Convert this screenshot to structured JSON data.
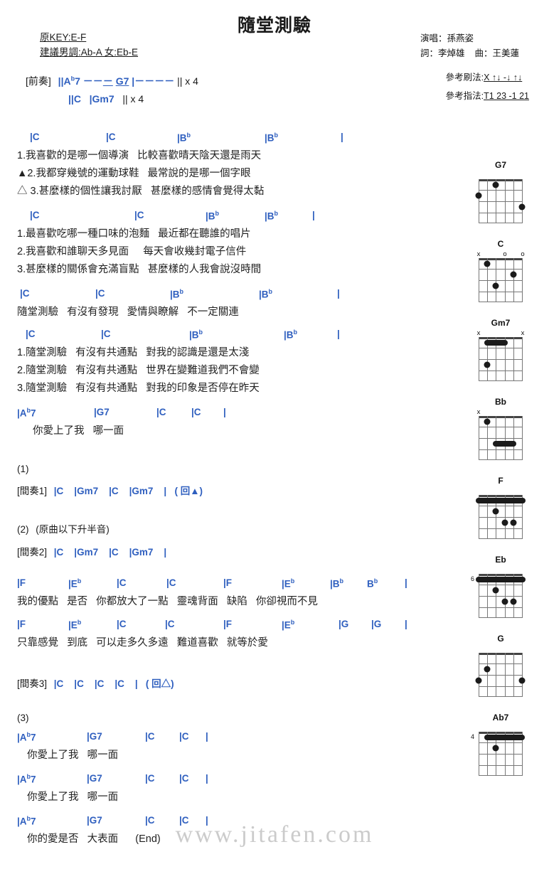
{
  "title": "隨堂測驗",
  "header": {
    "key_line": "原KEY:E-F",
    "suggest_line": "建議男調:Ab-A 女:Eb-E",
    "singer": "演唱：孫燕姿",
    "lyricist": "詞：李焯雄",
    "composer": "曲：王美蓮",
    "strum_label": "參考刷法:",
    "strum_value": "X ↑↓  -↓ ↑↓",
    "finger_label": "參考指法:",
    "finger_value": "T1 23 -1 21"
  },
  "intro": {
    "label": "[前奏]",
    "line1_chords": "||Ab7  －－－  G7  |－－－－  || x 4",
    "line2_chords": "||C    |Gm7    || x 4"
  },
  "sections": [
    {
      "name": "verse1",
      "chords": [
        "|C",
        "|C",
        "|Bb",
        "|Bb",
        "|"
      ],
      "lyrics": [
        "1.我喜歡的是哪一個導演   比較喜歡晴天陰天還是雨天",
        "▲2.我都穿幾號的運動球鞋   最常說的是哪一個字眼",
        "△ 3.甚麼樣的個性讓我討厭   甚麼樣的感情會覺得太黏"
      ]
    },
    {
      "name": "verse2",
      "chords": [
        "|C",
        "|C",
        "|Bb",
        "|Bb",
        "|"
      ],
      "lyrics": [
        "1.最喜歡吃哪一種口味的泡麵   最近都在聽誰的唱片",
        "2.我喜歡和誰聊天多見面     每天會收幾封電子信件",
        "3.甚麼樣的關係會充滿盲點   甚麼樣的人我會說沒時間"
      ]
    },
    {
      "name": "chorus-intro",
      "chords": [
        "|C",
        "|C",
        "|Bb",
        "|Bb",
        "|"
      ],
      "lyrics": [
        "隨堂測驗   有沒有發現   愛情與瞭解   不一定關連"
      ]
    },
    {
      "name": "chorus",
      "chords": [
        "|C",
        "|C",
        "|Bb",
        "|Bb",
        "|"
      ],
      "lyrics": [
        "1.隨堂測驗   有沒有共通點   對我的認識是還是太淺",
        "2.隨堂測驗   有沒有共通點   世界在變難道我們不會變",
        "3.隨堂測驗   有沒有共通點   對我的印象是否停在昨天"
      ]
    },
    {
      "name": "tag1",
      "chords": [
        "|Ab7",
        "|G7",
        "|C",
        "|C",
        "|"
      ],
      "lyrics": [
        "你愛上了我   哪一面"
      ]
    }
  ],
  "interlude1": {
    "number": "(1)",
    "label": "[間奏1]",
    "chords": "|C    |Gm7    |C    |Gm7    |   ( 回▲)"
  },
  "interlude2": {
    "number": "(2)",
    "note": "(原曲以下升半音)",
    "label": "[間奏2]",
    "chords": "|C    |Gm7    |C    |Gm7    |"
  },
  "bridge1": {
    "chords": [
      "|F",
      "|Eb",
      "|C",
      "|C",
      "|F",
      "|Eb",
      "|Bb",
      "Bb",
      "|"
    ],
    "lyric": "我的優點   是否   你都放大了一點   靈魂背面   缺陷   你卻視而不見"
  },
  "bridge2": {
    "chords": [
      "|F",
      "|Eb",
      "|C",
      "|C",
      "|F",
      "|Eb",
      "|G",
      "|G",
      "|"
    ],
    "lyric": "只靠感覺   到底   可以走多久多遠   難道喜歡   就等於愛"
  },
  "interlude3": {
    "label": "[間奏3]",
    "chords": "|C    |C    |C    |C    |   ( 回△)"
  },
  "ending": {
    "number": "(3)",
    "lines": [
      {
        "chords": [
          "|Ab7",
          "|G7",
          "|C",
          "|C",
          "|"
        ],
        "lyric": "你愛上了我   哪一面"
      },
      {
        "chords": [
          "|Ab7",
          "|G7",
          "|C",
          "|C",
          "|"
        ],
        "lyric": "你愛上了我   哪一面"
      },
      {
        "chords": [
          "|Ab7",
          "|G7",
          "|C",
          "|C",
          "|"
        ],
        "lyric": "你的愛是否   大表面      (End)"
      }
    ]
  },
  "diagrams": [
    {
      "name": "G7",
      "top": [
        {
          "label": "",
          "x": 0
        }
      ],
      "fret_label": "",
      "dots": [
        [
          2,
          1
        ],
        [
          0,
          2
        ],
        [
          5,
          3
        ]
      ],
      "barre": null
    },
    {
      "name": "C",
      "top": [
        {
          "label": "x",
          "x": 0
        },
        {
          "label": "o",
          "x": 3
        },
        {
          "label": "o",
          "x": 5
        }
      ],
      "fret_label": "",
      "dots": [
        [
          1,
          1
        ],
        [
          4,
          2
        ],
        [
          2,
          3
        ]
      ],
      "barre": null
    },
    {
      "name": "Gm7",
      "top": [
        {
          "label": "x",
          "x": 0
        },
        {
          "label": "x",
          "x": 5
        }
      ],
      "fret_label": "",
      "dots": [
        [
          1,
          1
        ],
        [
          2,
          1
        ],
        [
          3,
          1
        ],
        [
          4,
          1
        ],
        [
          1,
          3
        ]
      ],
      "barre": {
        "from": 1,
        "to": 4,
        "fret": 1
      }
    },
    {
      "name": "Bb",
      "top": [
        {
          "label": "x",
          "x": 0
        }
      ],
      "fret_label": "",
      "dots": [
        [
          1,
          1
        ],
        [
          2,
          3
        ],
        [
          3,
          3
        ],
        [
          4,
          3
        ],
        [
          5,
          3
        ]
      ],
      "barre": {
        "from": 2,
        "to": 5,
        "fret": 3
      }
    },
    {
      "name": "F",
      "top": [],
      "fret_label": "",
      "dots": [
        [
          0,
          1
        ],
        [
          1,
          1
        ],
        [
          2,
          2
        ],
        [
          3,
          3
        ],
        [
          4,
          3
        ],
        [
          5,
          1
        ]
      ],
      "barre": {
        "from": 0,
        "to": 5,
        "fret": 1
      }
    },
    {
      "name": "Eb",
      "top": [],
      "fret_label": "6",
      "dots": [
        [
          0,
          1
        ],
        [
          1,
          1
        ],
        [
          2,
          2
        ],
        [
          3,
          3
        ],
        [
          4,
          3
        ],
        [
          5,
          1
        ]
      ],
      "barre": {
        "from": 0,
        "to": 5,
        "fret": 1
      }
    },
    {
      "name": "G",
      "top": [],
      "fret_label": "",
      "dots": [
        [
          0,
          3
        ],
        [
          1,
          2
        ],
        [
          5,
          3
        ]
      ],
      "barre": null
    },
    {
      "name": "Ab7",
      "top": [],
      "fret_label": "4",
      "dots": [
        [
          1,
          1
        ],
        [
          3,
          1
        ],
        [
          5,
          1
        ],
        [
          2,
          2
        ]
      ],
      "barre": {
        "from": 1,
        "to": 5,
        "fret": 1
      }
    }
  ],
  "watermark": "www.jitafen.com"
}
